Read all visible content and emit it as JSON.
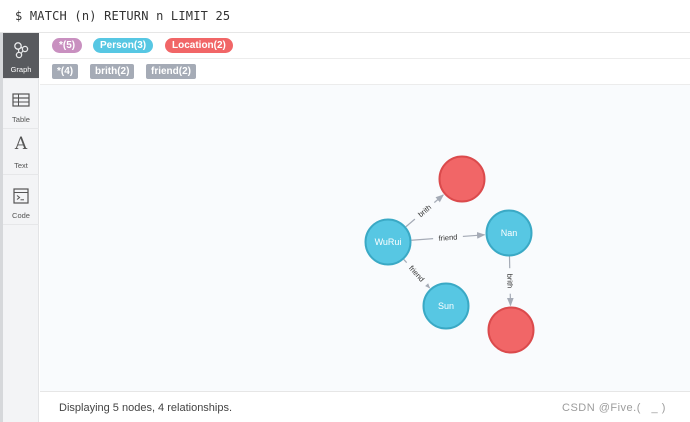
{
  "query": {
    "text": "$ MATCH (n) RETURN n LIMIT 25"
  },
  "sidebar": {
    "items": [
      {
        "label": "Graph",
        "icon": "graph-icon",
        "active": true
      },
      {
        "label": "Table",
        "icon": "table-icon",
        "active": false
      },
      {
        "label": "Text",
        "icon": "text-icon",
        "active": false
      },
      {
        "label": "Code",
        "icon": "code-icon",
        "active": false
      }
    ]
  },
  "node_labels": [
    {
      "text": "*(5)",
      "color": "#c990c0"
    },
    {
      "text": "Person(3)",
      "color": "#57c7e3"
    },
    {
      "text": "Location(2)",
      "color": "#f16667"
    }
  ],
  "relationship_types": [
    {
      "text": "*(4)"
    },
    {
      "text": "brith(2)"
    },
    {
      "text": "friend(2)"
    }
  ],
  "graph": {
    "nodes": [
      {
        "id": "wurui",
        "caption": "WuRui",
        "color": "#57c7e3"
      },
      {
        "id": "nan",
        "caption": "Nan",
        "color": "#57c7e3"
      },
      {
        "id": "sun",
        "caption": "Sun",
        "color": "#57c7e3"
      },
      {
        "id": "loc1",
        "caption": "",
        "color": "#f16667"
      },
      {
        "id": "loc2",
        "caption": "",
        "color": "#f16667"
      }
    ],
    "relationships": [
      {
        "from": "wurui",
        "to": "loc1",
        "type": "brith"
      },
      {
        "from": "wurui",
        "to": "nan",
        "type": "friend"
      },
      {
        "from": "wurui",
        "to": "sun",
        "type": "friend"
      },
      {
        "from": "nan",
        "to": "loc2",
        "type": "brith"
      }
    ]
  },
  "footer": {
    "status": "Displaying 5 nodes, 4 relationships.",
    "watermark": "CSDN @Five.(   _ )"
  },
  "colors": {
    "node_stroke_person": "#3aa9c5",
    "node_stroke_location": "#db4a4c",
    "edge": "#a5abb6"
  }
}
